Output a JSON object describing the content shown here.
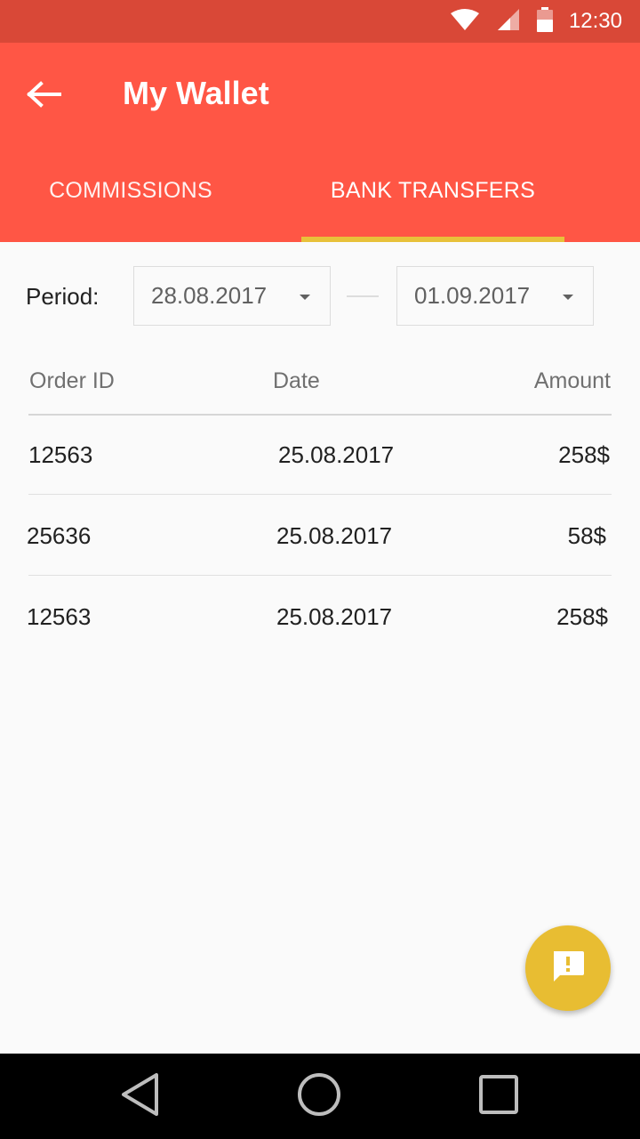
{
  "status_bar": {
    "time": "12:30",
    "icons": [
      "wifi-icon",
      "signal-icon",
      "battery-icon"
    ],
    "background": "#d94837"
  },
  "app_bar": {
    "title": "My Wallet",
    "back_icon": "arrow-back-icon",
    "background": "#ff5645"
  },
  "tabs": [
    {
      "label": "COMMISSIONS",
      "selected": false
    },
    {
      "label": "BANK TRANSFERS",
      "selected": true
    }
  ],
  "tab_indicator_color": "#e8c13a",
  "period": {
    "label": "Period:",
    "from": "28.08.2017",
    "to": "01.09.2017"
  },
  "table": {
    "headers": [
      "Order ID",
      "Date",
      "Amount"
    ],
    "rows": [
      {
        "order_id": "12563",
        "date": "25.08.2017",
        "amount": "258$"
      },
      {
        "order_id": "25636",
        "date": "25.08.2017",
        "amount": "58$"
      },
      {
        "order_id": "12563",
        "date": "25.08.2017",
        "amount": "258$"
      }
    ]
  },
  "fab": {
    "icon": "feedback-icon",
    "color": "#e8bd32"
  },
  "nav_bar": {
    "icons": [
      "nav-back-icon",
      "nav-home-icon",
      "nav-recent-icon"
    ]
  }
}
